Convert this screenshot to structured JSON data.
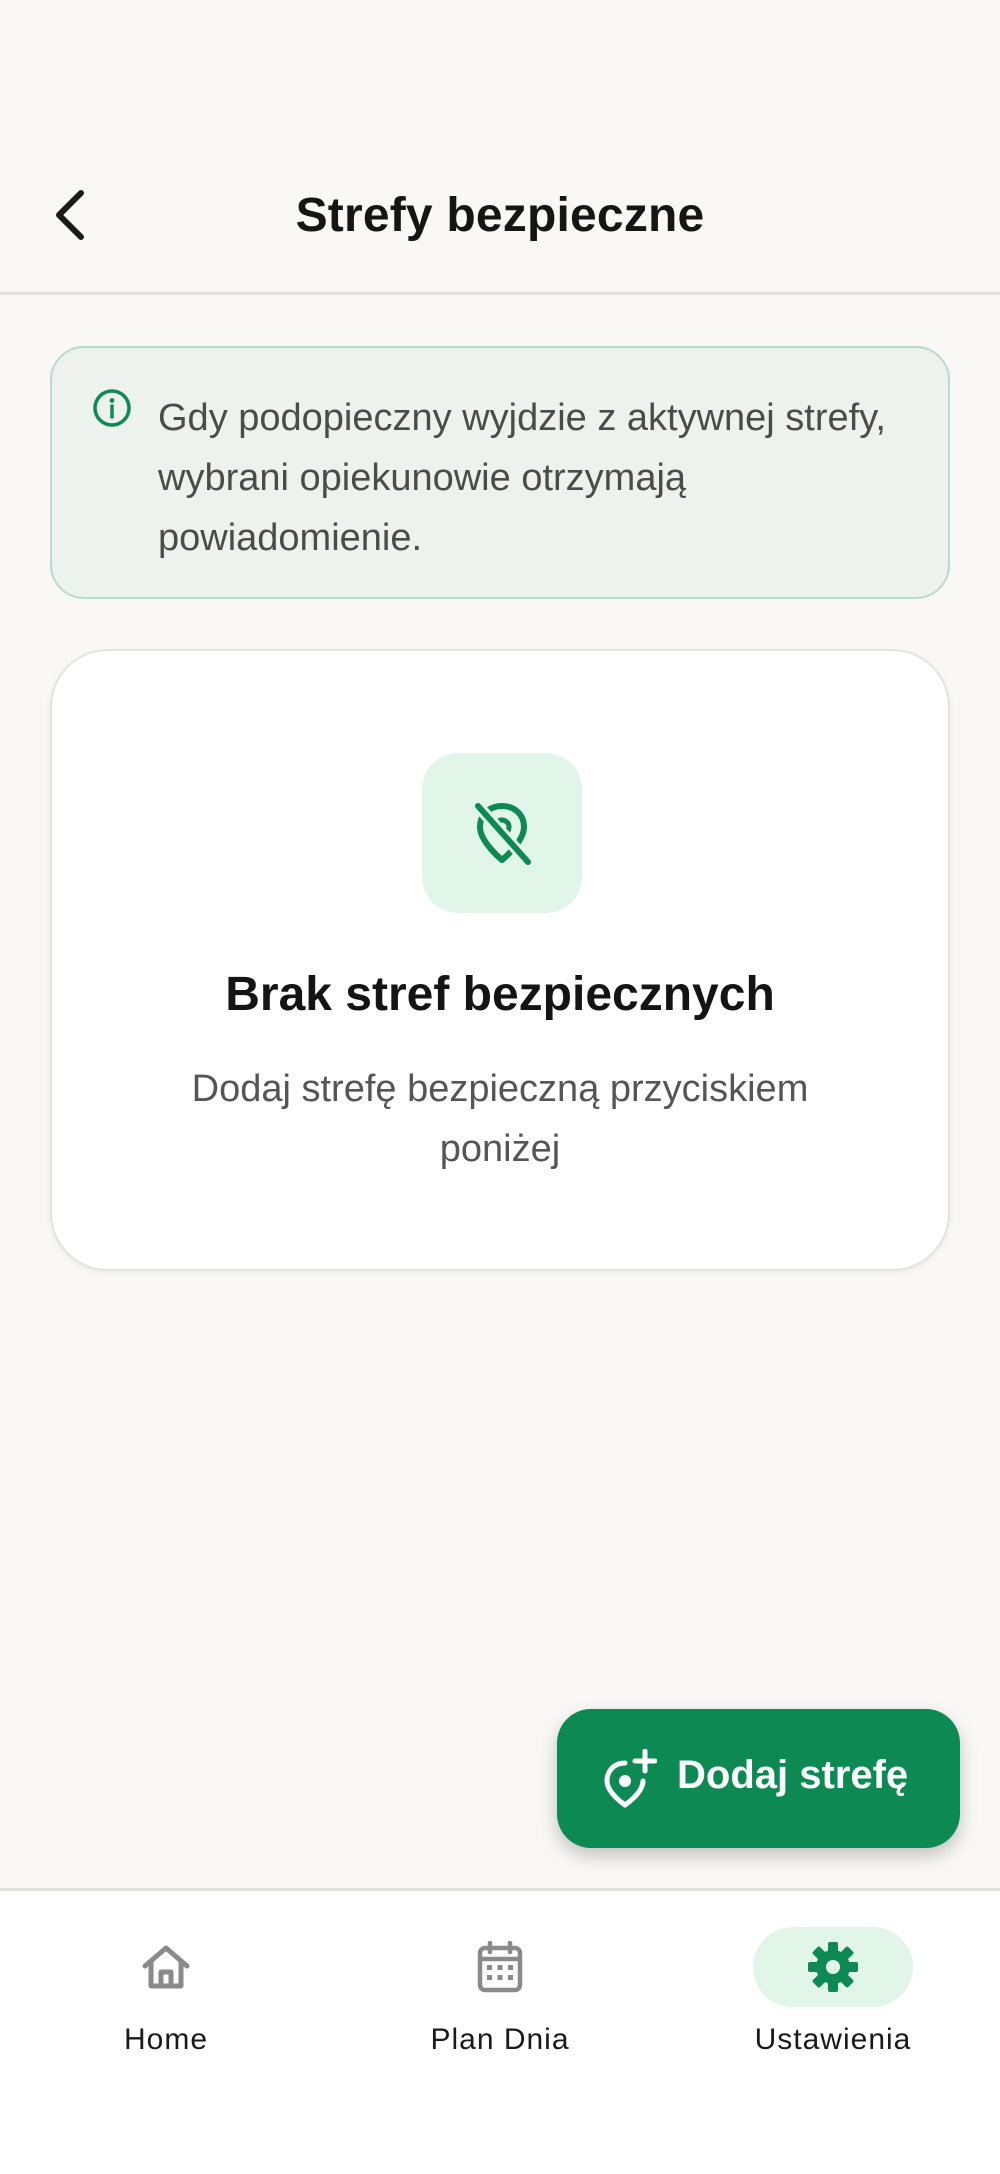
{
  "header": {
    "title": "Strefy bezpieczne",
    "back_icon": "chevron-left-icon"
  },
  "info_banner": {
    "icon": "info-icon",
    "text": "Gdy podopieczny wyjdzie z aktywnej strefy, wybrani opiekunowie otrzymają powiadomienie."
  },
  "empty_state": {
    "icon": "location-off-icon",
    "title": "Brak stref bezpiecznych",
    "subtitle": "Dodaj strefę bezpieczną przyciskiem poniżej"
  },
  "fab": {
    "icon": "add-location-icon",
    "label": "Dodaj strefę"
  },
  "bottom_nav": {
    "items": [
      {
        "label": "Home",
        "icon": "home-icon",
        "active": false
      },
      {
        "label": "Plan Dnia",
        "icon": "calendar-icon",
        "active": false
      },
      {
        "label": "Ustawienia",
        "icon": "gear-icon",
        "active": true
      }
    ]
  },
  "colors": {
    "accent": "#0d8a53",
    "accent_light": "#e1f5e8",
    "banner_bg": "#edf2ee",
    "background": "#f9f8f6"
  }
}
